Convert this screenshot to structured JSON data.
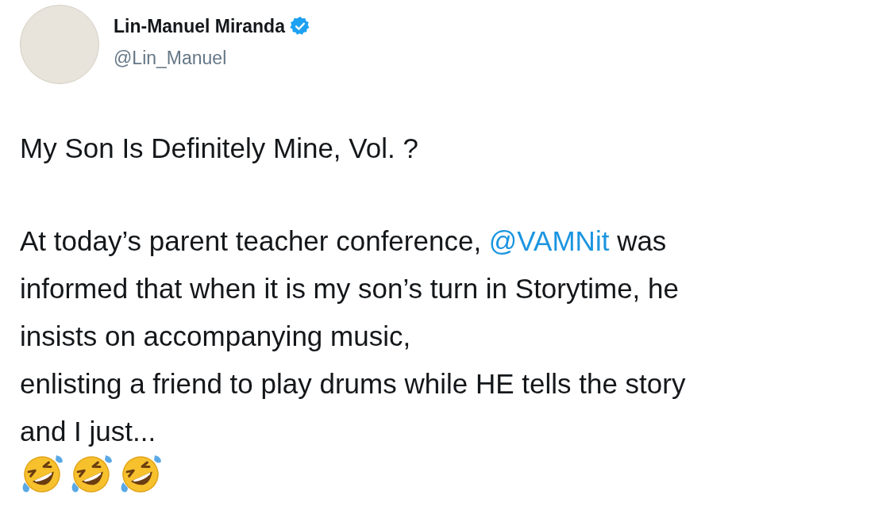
{
  "author": {
    "name": "Lin-Manuel Miranda",
    "verified": true,
    "handle": "@Lin_Manuel"
  },
  "tweet": {
    "title": "My Son Is Definitely Mine, Vol. ?",
    "lines": [
      [
        {
          "kind": "text",
          "text": "At today’s parent teacher conference, "
        },
        {
          "kind": "mention",
          "text": "@VAMNit"
        },
        {
          "kind": "text",
          "text": " was"
        }
      ],
      [
        {
          "kind": "text",
          "text": "informed that when it is my son’s turn in Storytime, he"
        }
      ],
      [
        {
          "kind": "text",
          "text": "insists on accompanying music,"
        }
      ],
      [
        {
          "kind": "text",
          "text": "enlisting a friend to play drums while HE tells the story"
        }
      ],
      [
        {
          "kind": "text",
          "text": "and I just..."
        }
      ]
    ]
  }
}
